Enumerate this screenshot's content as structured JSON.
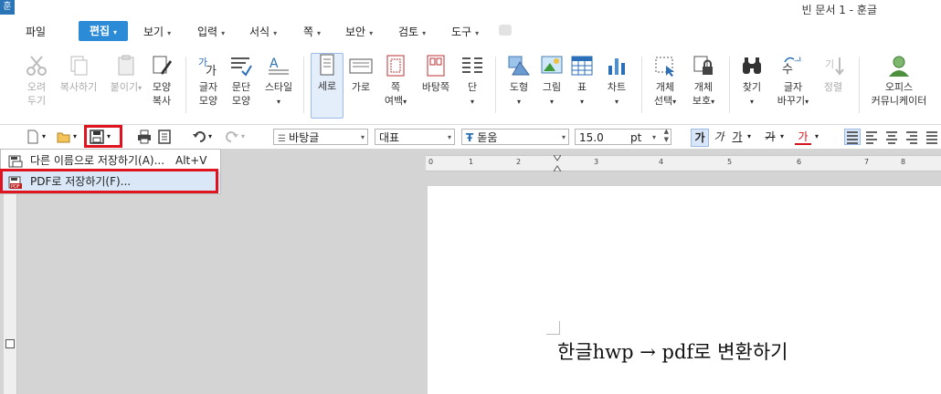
{
  "app": {
    "icon_glyph": "훈",
    "title": "빈 문서 1 - 훈글"
  },
  "menu": {
    "file": "파일",
    "edit": "편집",
    "view": "보기",
    "insert": "입력",
    "format": "서식",
    "page": "쪽",
    "security": "보안",
    "review": "검토",
    "tools": "도구"
  },
  "ribbon": {
    "cut": [
      "오려",
      "두기"
    ],
    "copy": "복사하기",
    "paste": "붙이기",
    "format_copy": [
      "모양",
      "복사"
    ],
    "char_shape": [
      "글자",
      "모양"
    ],
    "para_shape": [
      "문단",
      "모양"
    ],
    "style": "스타일",
    "portrait": "세로",
    "landscape": "가로",
    "page_margin": [
      "쪽",
      "여백"
    ],
    "background": "바탕쪽",
    "columns": "단",
    "shape": "도형",
    "picture": "그림",
    "table": "표",
    "chart": "차트",
    "object_select": [
      "개체",
      "선택"
    ],
    "object_protect": [
      "개체",
      "보호"
    ],
    "find": "찾기",
    "replace": [
      "글자",
      "바꾸기"
    ],
    "sort": "정렬",
    "office_messenger": [
      "오피스",
      "커뮤니케이터"
    ]
  },
  "toolbar": {
    "style_value": "바탕글",
    "lang_value": "대표",
    "font_value": "돋움",
    "size_value": "15.0",
    "size_unit": "pt",
    "bold_glyph": "가",
    "italic_glyph": "가",
    "underline_glyph": "가",
    "strike_glyph": "가",
    "color_glyph": "가"
  },
  "save_menu": {
    "save_as": "다른 이름으로 저장하기(A)...",
    "save_as_key": "Alt+V",
    "save_pdf": "PDF로 저장하기(F)..."
  },
  "ruler": {
    "marks": [
      "0",
      "1",
      "2",
      "3",
      "4",
      "5",
      "6",
      "7",
      "8"
    ]
  },
  "document": {
    "text": "한글hwp → pdf로 변환하기"
  },
  "colors": {
    "accent": "#2b8bd6",
    "highlight": "#e0141e"
  }
}
